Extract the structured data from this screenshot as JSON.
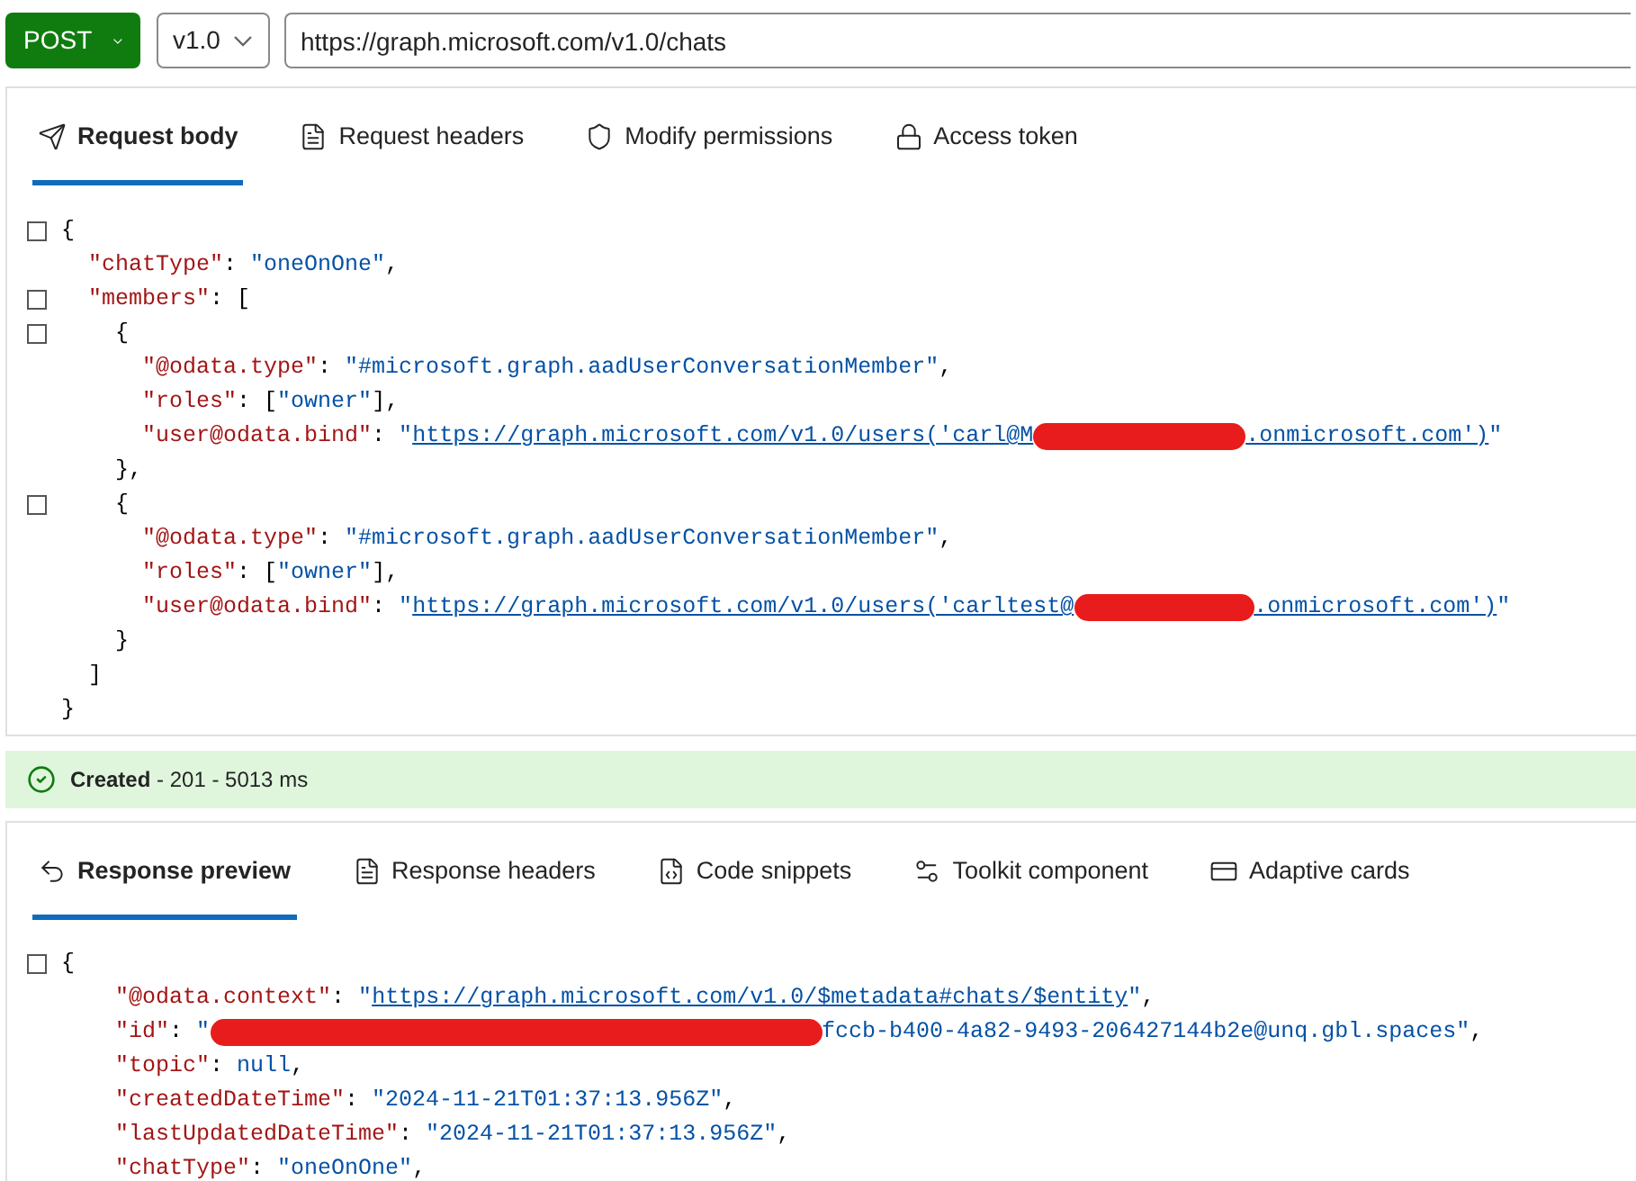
{
  "request_bar": {
    "method": "POST",
    "version": "v1.0",
    "url": "https://graph.microsoft.com/v1.0/chats"
  },
  "request_tabs": [
    {
      "label": "Request body",
      "selected": true
    },
    {
      "label": "Request headers",
      "selected": false
    },
    {
      "label": "Modify permissions",
      "selected": false
    },
    {
      "label": "Access token",
      "selected": false
    }
  ],
  "request_body": [
    {
      "foldable": true,
      "tokens": [
        {
          "kind": "punct",
          "text": "{"
        }
      ]
    },
    {
      "foldable": false,
      "tokens": [
        {
          "kind": "key",
          "text": "  \"chatType\""
        },
        {
          "kind": "punct",
          "text": ": "
        },
        {
          "kind": "string",
          "text": "\"oneOnOne\""
        },
        {
          "kind": "punct",
          "text": ","
        }
      ]
    },
    {
      "foldable": true,
      "tokens": [
        {
          "kind": "key",
          "text": "  \"members\""
        },
        {
          "kind": "punct",
          "text": ": ["
        }
      ]
    },
    {
      "foldable": true,
      "tokens": [
        {
          "kind": "punct",
          "text": "    {"
        }
      ]
    },
    {
      "foldable": false,
      "tokens": [
        {
          "kind": "key",
          "text": "      \"@odata.type\""
        },
        {
          "kind": "punct",
          "text": ": "
        },
        {
          "kind": "string",
          "text": "\"#microsoft.graph.aadUserConversationMember\""
        },
        {
          "kind": "punct",
          "text": ","
        }
      ]
    },
    {
      "foldable": false,
      "tokens": [
        {
          "kind": "key",
          "text": "      \"roles\""
        },
        {
          "kind": "punct",
          "text": ": ["
        },
        {
          "kind": "string",
          "text": "\"owner\""
        },
        {
          "kind": "punct",
          "text": "],"
        }
      ]
    },
    {
      "foldable": false,
      "tokens": [
        {
          "kind": "key",
          "text": "      \"user@odata.bind\""
        },
        {
          "kind": "punct",
          "text": ": "
        },
        {
          "kind": "string",
          "text": "\""
        },
        {
          "kind": "link",
          "text": "https://graph.microsoft.com/v1.0/users('carl@M"
        },
        {
          "kind": "redaction"
        },
        {
          "kind": "link",
          "text": ".onmicrosoft.com')"
        },
        {
          "kind": "string",
          "text": "\""
        }
      ]
    },
    {
      "foldable": false,
      "tokens": [
        {
          "kind": "punct",
          "text": "    },"
        }
      ]
    },
    {
      "foldable": true,
      "tokens": [
        {
          "kind": "punct",
          "text": "    {"
        }
      ]
    },
    {
      "foldable": false,
      "tokens": [
        {
          "kind": "key",
          "text": "      \"@odata.type\""
        },
        {
          "kind": "punct",
          "text": ": "
        },
        {
          "kind": "string",
          "text": "\"#microsoft.graph.aadUserConversationMember\""
        },
        {
          "kind": "punct",
          "text": ","
        }
      ]
    },
    {
      "foldable": false,
      "tokens": [
        {
          "kind": "key",
          "text": "      \"roles\""
        },
        {
          "kind": "punct",
          "text": ": ["
        },
        {
          "kind": "string",
          "text": "\"owner\""
        },
        {
          "kind": "punct",
          "text": "],"
        }
      ]
    },
    {
      "foldable": false,
      "tokens": [
        {
          "kind": "key",
          "text": "      \"user@odata.bind\""
        },
        {
          "kind": "punct",
          "text": ": "
        },
        {
          "kind": "string",
          "text": "\""
        },
        {
          "kind": "link",
          "text": "https://graph.microsoft.com/v1.0/users('carltest@"
        },
        {
          "kind": "redaction"
        },
        {
          "kind": "link",
          "text": ".onmicrosoft.com')"
        },
        {
          "kind": "string",
          "text": "\""
        }
      ]
    },
    {
      "foldable": false,
      "tokens": [
        {
          "kind": "punct",
          "text": "    }"
        }
      ]
    },
    {
      "foldable": false,
      "tokens": [
        {
          "kind": "punct",
          "text": "  ]"
        }
      ]
    },
    {
      "foldable": false,
      "tokens": [
        {
          "kind": "punct",
          "text": "}"
        }
      ]
    }
  ],
  "status": {
    "title": "Created",
    "detail": " - 201 - 5013 ms"
  },
  "response_tabs": [
    {
      "label": "Response preview",
      "selected": true
    },
    {
      "label": "Response headers",
      "selected": false
    },
    {
      "label": "Code snippets",
      "selected": false
    },
    {
      "label": "Toolkit component",
      "selected": false
    },
    {
      "label": "Adaptive cards",
      "selected": false
    }
  ],
  "response_body": [
    {
      "foldable": true,
      "tokens": [
        {
          "kind": "punct",
          "text": "{"
        }
      ]
    },
    {
      "foldable": false,
      "tokens": [
        {
          "kind": "key",
          "text": "    \"@odata.context\""
        },
        {
          "kind": "punct",
          "text": ": "
        },
        {
          "kind": "string",
          "text": "\""
        },
        {
          "kind": "link",
          "text": "https://graph.microsoft.com/v1.0/$metadata#chats/$entity"
        },
        {
          "kind": "string",
          "text": "\""
        },
        {
          "kind": "punct",
          "text": ","
        }
      ]
    },
    {
      "foldable": false,
      "tokens": [
        {
          "kind": "key",
          "text": "    \"id\""
        },
        {
          "kind": "punct",
          "text": ": "
        },
        {
          "kind": "string",
          "text": "\""
        },
        {
          "kind": "redaction"
        },
        {
          "kind": "string",
          "text": "fccb-b400-4a82-9493-206427144b2e@unq.gbl.spaces\""
        },
        {
          "kind": "punct",
          "text": ","
        }
      ]
    },
    {
      "foldable": false,
      "tokens": [
        {
          "kind": "key",
          "text": "    \"topic\""
        },
        {
          "kind": "punct",
          "text": ": "
        },
        {
          "kind": "string",
          "text": "null"
        },
        {
          "kind": "punct",
          "text": ","
        }
      ]
    },
    {
      "foldable": false,
      "tokens": [
        {
          "kind": "key",
          "text": "    \"createdDateTime\""
        },
        {
          "kind": "punct",
          "text": ": "
        },
        {
          "kind": "string",
          "text": "\"2024-11-21T01:37:13.956Z\""
        },
        {
          "kind": "punct",
          "text": ","
        }
      ]
    },
    {
      "foldable": false,
      "tokens": [
        {
          "kind": "key",
          "text": "    \"lastUpdatedDateTime\""
        },
        {
          "kind": "punct",
          "text": ": "
        },
        {
          "kind": "string",
          "text": "\"2024-11-21T01:37:13.956Z\""
        },
        {
          "kind": "punct",
          "text": ","
        }
      ]
    },
    {
      "foldable": false,
      "tokens": [
        {
          "kind": "key",
          "text": "    \"chatType\""
        },
        {
          "kind": "punct",
          "text": ": "
        },
        {
          "kind": "string",
          "text": "\"oneOnOne\""
        },
        {
          "kind": "punct",
          "text": ","
        }
      ]
    }
  ]
}
